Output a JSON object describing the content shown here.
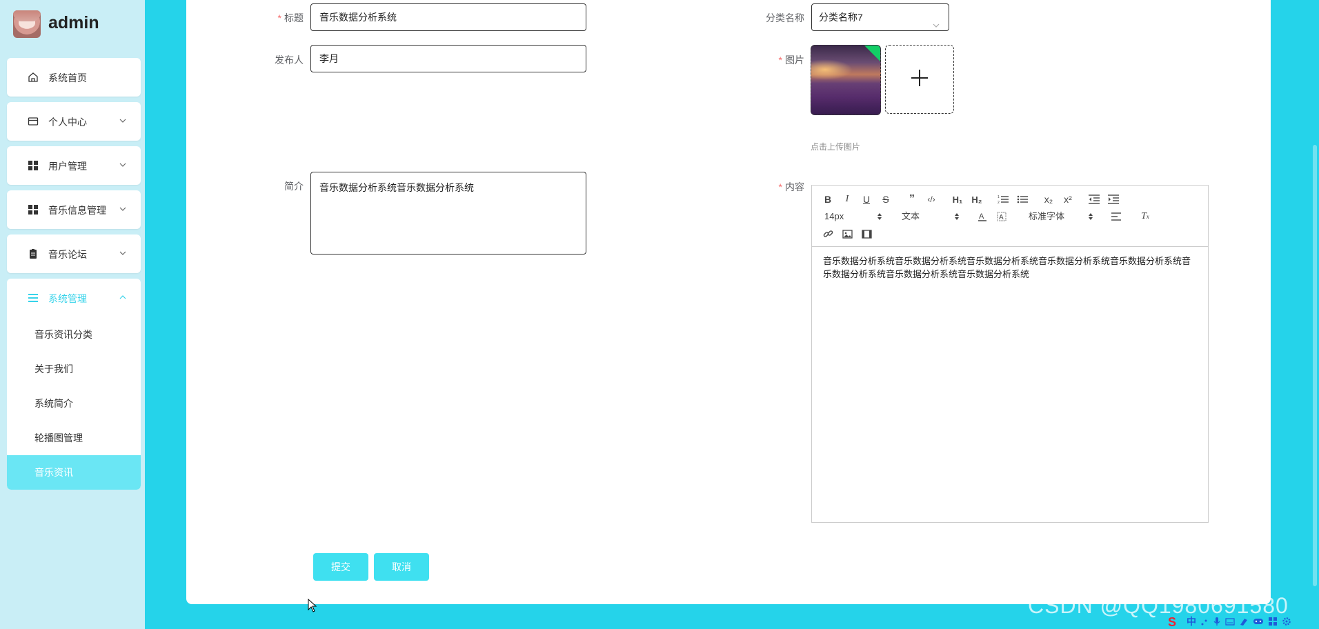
{
  "sidebar": {
    "username": "admin",
    "items": [
      {
        "label": "系统首页",
        "icon": "home-icon"
      },
      {
        "label": "个人中心",
        "icon": "card-icon"
      },
      {
        "label": "用户管理",
        "icon": "grid-icon"
      },
      {
        "label": "音乐信息管理",
        "icon": "grid-icon"
      },
      {
        "label": "音乐论坛",
        "icon": "clipboard-icon"
      }
    ],
    "system_group": {
      "label": "系统管理",
      "icon": "menu-lines-icon",
      "subitems": [
        "音乐资讯分类",
        "关于我们",
        "系统简介",
        "轮播图管理",
        "音乐资讯"
      ],
      "active_index": 4
    }
  },
  "form": {
    "title_label": "标题",
    "title_value": "音乐数据分析系统",
    "publisher_label": "发布人",
    "publisher_value": "李月",
    "intro_label": "简介",
    "intro_value": "音乐数据分析系统音乐数据分析系统",
    "category_label": "分类名称",
    "category_value": "分类名称7",
    "image_label": "图片",
    "upload_tip": "点击上传图片",
    "content_label": "内容",
    "editor": {
      "font_size": "14px",
      "header_picker": "文本",
      "font_picker": "标准字体",
      "content": "音乐数据分析系统音乐数据分析系统音乐数据分析系统音乐数据分析系统音乐数据分析系统音乐数据分析系统音乐数据分析系统音乐数据分析系统"
    },
    "submit_label": "提交",
    "cancel_label": "取消"
  },
  "watermark": "CSDN @QQ1980691580",
  "tray": {
    "ime_label": "中"
  },
  "colors": {
    "accent": "#37d3ea",
    "background": "#25d3ea",
    "sidebar": "#c9eef6",
    "active_item": "#6ae6f4",
    "required": "#f56c6c",
    "button": "#3fe0f0"
  }
}
